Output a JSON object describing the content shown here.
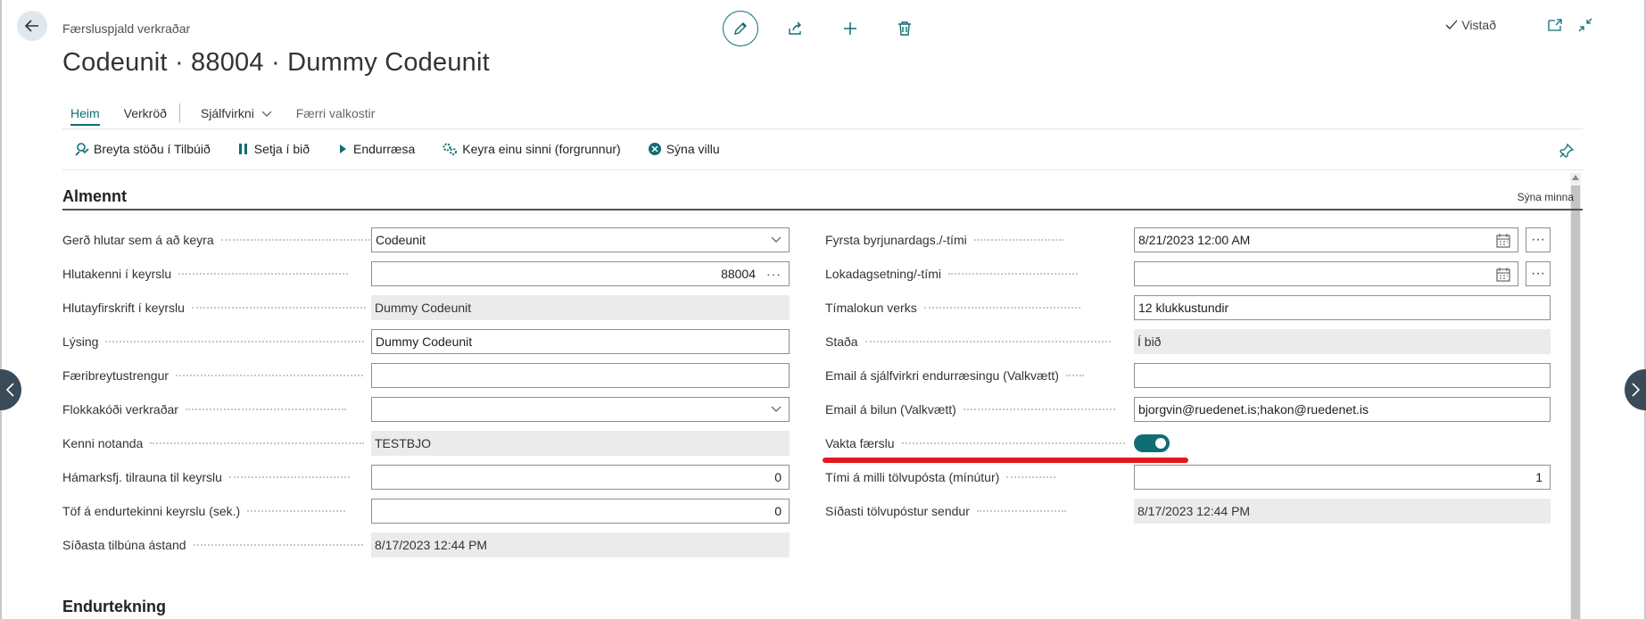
{
  "header": {
    "breadcrumb": "Færsluspjald verkraðar",
    "title": "Codeunit · 88004 · Dummy Codeunit",
    "saved_label": "Vistað"
  },
  "tabs": [
    {
      "label": "Heim"
    },
    {
      "label": "Verkröð"
    },
    {
      "label": "Sjálfvirkni"
    },
    {
      "label": "Færri valkostir"
    }
  ],
  "actions": [
    {
      "label": "Breyta stöðu í Tilbúið"
    },
    {
      "label": "Setja í bið"
    },
    {
      "label": "Endurræsa"
    },
    {
      "label": "Keyra einu sinni (forgrunnur)"
    },
    {
      "label": "Sýna villu"
    }
  ],
  "section": {
    "title": "Almennt",
    "show_less": "Sýna minna",
    "next_title": "Endurtekning"
  },
  "left_fields": [
    {
      "label": "Gerð hlutar sem á að keyra",
      "value": "Codeunit"
    },
    {
      "label": "Hlutakenni í keyrslu",
      "value": "88004"
    },
    {
      "label": "Hlutayfirskrift í keyrslu",
      "value": "Dummy Codeunit"
    },
    {
      "label": "Lýsing",
      "value": "Dummy Codeunit"
    },
    {
      "label": "Færibreytustrengur",
      "value": ""
    },
    {
      "label": "Flokkakóði verkraðar",
      "value": ""
    },
    {
      "label": "Kenni notanda",
      "value": "TESTBJO"
    },
    {
      "label": "Hámarksfj. tilrauna til keyrslu",
      "value": "0"
    },
    {
      "label": "Töf á endurtekinni keyrslu (sek.)",
      "value": "0"
    },
    {
      "label": "Síðasta tilbúna ástand",
      "value": "8/17/2023 12:44 PM"
    }
  ],
  "right_fields": [
    {
      "label": "Fyrsta byrjunardags./-tími",
      "value": "8/21/2023 12:00 AM"
    },
    {
      "label": "Lokadagsetning/-tími",
      "value": ""
    },
    {
      "label": "Tímalokun verks",
      "value": "12 klukkustundir"
    },
    {
      "label": "Staða",
      "value": "Í bið"
    },
    {
      "label": "Email á sjálfvirkri endurræsingu (Valkvætt)",
      "value": ""
    },
    {
      "label": "Email á bilun (Valkvætt)",
      "value": "bjorgvin@ruedenet.is;hakon@ruedenet.is"
    },
    {
      "label": "Vakta færslu",
      "value": "on"
    },
    {
      "label": "Tími á milli tölvupósta (mínútur)",
      "value": "1"
    },
    {
      "label": "Síðasti tölvupóstur sendur",
      "value": "8/17/2023 12:44 PM"
    }
  ],
  "colors": {
    "accent": "#0e6e73",
    "highlight": "#e3171d"
  }
}
